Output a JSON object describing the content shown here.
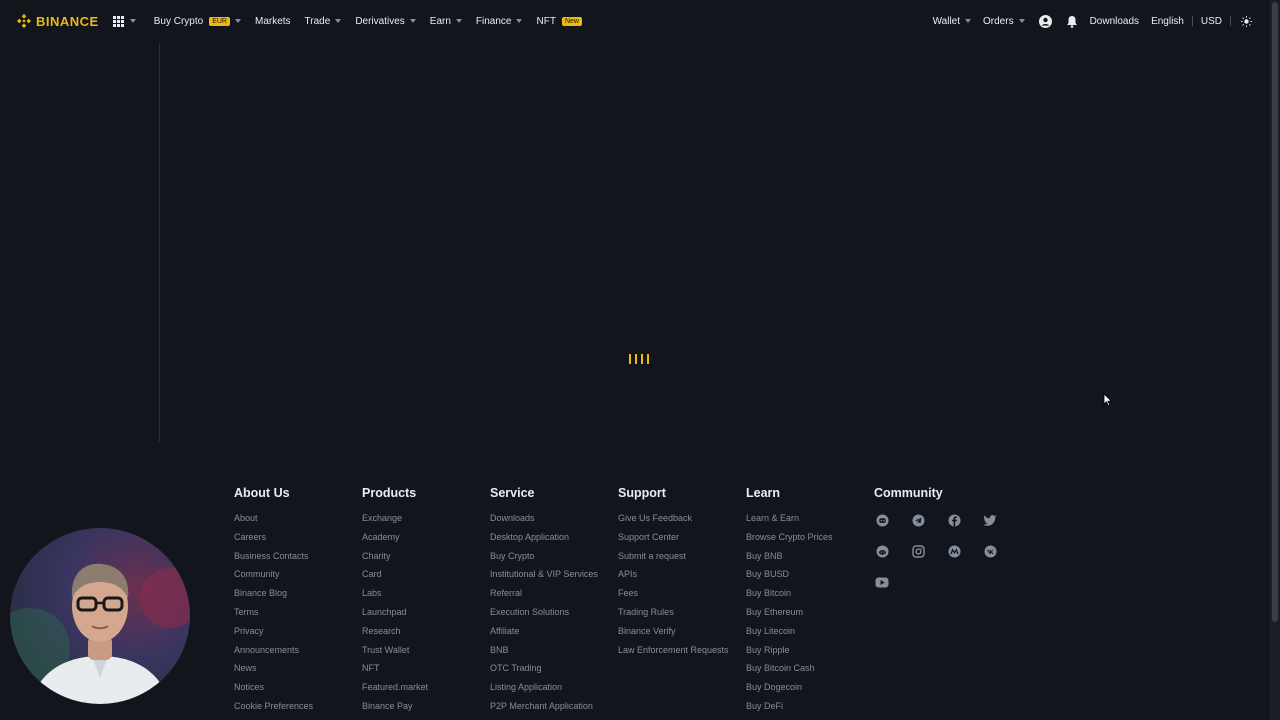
{
  "nav": {
    "brand": "BINANCE",
    "items": [
      {
        "label": "Buy Crypto",
        "badge": "EUR",
        "caret": true
      },
      {
        "label": "Markets",
        "caret": false
      },
      {
        "label": "Trade",
        "caret": true
      },
      {
        "label": "Derivatives",
        "caret": true
      },
      {
        "label": "Earn",
        "caret": true
      },
      {
        "label": "Finance",
        "caret": true
      },
      {
        "label": "NFT",
        "badge": "New",
        "caret": false
      }
    ],
    "right": {
      "wallet": "Wallet",
      "orders": "Orders",
      "downloads": "Downloads",
      "language": "English",
      "currency": "USD"
    },
    "icons": {
      "apps": "grid-icon",
      "profile": "user-icon",
      "notifications": "bell-icon",
      "theme": "sun-icon"
    }
  },
  "colors": {
    "background": "#12161c",
    "accent": "#f0b90b",
    "text_primary": "#eaecef",
    "text_muted": "#848e9c"
  },
  "footer": {
    "columns": [
      {
        "title": "About Us",
        "links": [
          "About",
          "Careers",
          "Business Contacts",
          "Community",
          "Binance Blog",
          "Terms",
          "Privacy",
          "Announcements",
          "News",
          "Notices",
          "Cookie Preferences"
        ]
      },
      {
        "title": "Products",
        "links": [
          "Exchange",
          "Academy",
          "Charity",
          "Card",
          "Labs",
          "Launchpad",
          "Research",
          "Trust Wallet",
          "NFT",
          "Featured.market",
          "Binance Pay"
        ]
      },
      {
        "title": "Service",
        "links": [
          "Downloads",
          "Desktop Application",
          "Buy Crypto",
          "Institutional & VIP Services",
          "Referral",
          "Execution Solutions",
          "Affiliate",
          "BNB",
          "OTC Trading",
          "Listing Application",
          "P2P Merchant Application"
        ]
      },
      {
        "title": "Support",
        "links": [
          "Give Us Feedback",
          "Support Center",
          "Submit a request",
          "APIs",
          "Fees",
          "Trading Rules",
          "Binance Verify",
          "Law Enforcement Requests"
        ]
      },
      {
        "title": "Learn",
        "links": [
          "Learn & Earn",
          "Browse Crypto Prices",
          "Buy BNB",
          "Buy BUSD",
          "Buy Bitcoin",
          "Buy Ethereum",
          "Buy Litecoin",
          "Buy Ripple",
          "Buy Bitcoin Cash",
          "Buy Dogecoin",
          "Buy DeFi"
        ]
      }
    ],
    "community": {
      "title": "Community",
      "icons": [
        "discord-icon",
        "telegram-icon",
        "facebook-icon",
        "twitter-icon",
        "reddit-icon",
        "instagram-icon",
        "coinmarketcap-icon",
        "vk-icon",
        "youtube-icon"
      ]
    }
  }
}
